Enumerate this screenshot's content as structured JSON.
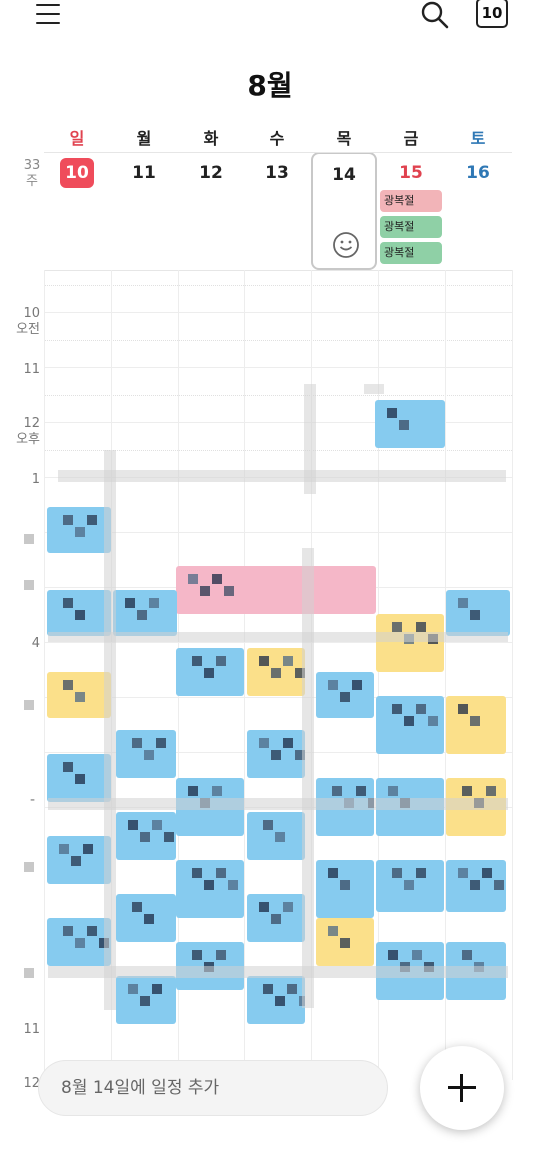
{
  "toolbar": {
    "menu_icon": "hamburger-menu-icon",
    "search_icon": "search-icon",
    "today_label": "10"
  },
  "month_title": "8월",
  "week": {
    "label_top": "33",
    "label_bottom": "주"
  },
  "weekdays": [
    {
      "label": "일",
      "color": "#e0424f"
    },
    {
      "label": "월",
      "color": "#222222"
    },
    {
      "label": "화",
      "color": "#222222"
    },
    {
      "label": "수",
      "color": "#222222"
    },
    {
      "label": "목",
      "color": "#222222"
    },
    {
      "label": "금",
      "color": "#222222"
    },
    {
      "label": "토",
      "color": "#2f78b5"
    }
  ],
  "dates": [
    {
      "day": "10",
      "color": "#ffffff"
    },
    {
      "day": "11",
      "color": "#222222"
    },
    {
      "day": "12",
      "color": "#222222"
    },
    {
      "day": "13",
      "color": "#222222"
    },
    {
      "day": "14",
      "color": "#222222"
    },
    {
      "day": "15",
      "color": "#e0424f"
    },
    {
      "day": "16",
      "color": "#2f78b5"
    }
  ],
  "holidays": [
    {
      "label": "광복절",
      "color": "#f2b4b8"
    },
    {
      "label": "광복절",
      "color": "#8fd0a6"
    },
    {
      "label": "광복절",
      "color": "#8fd0a6"
    }
  ],
  "hour_labels": [
    {
      "hour": "10",
      "period": "오전"
    },
    {
      "hour": "11",
      "period": ""
    },
    {
      "hour": "12",
      "period": "오후"
    },
    {
      "hour": "1",
      "period": ""
    },
    {
      "hour": "4",
      "period": ""
    },
    {
      "hour": "11",
      "period": ""
    },
    {
      "hour": "12",
      "period": ""
    }
  ],
  "stray_labels": [
    "-"
  ],
  "add_event_placeholder": "8월 14일에 일정 추가",
  "fab_icon": "plus-icon",
  "colors": {
    "today": "#ef4c5b",
    "event_blue": "#86cbef",
    "event_pink": "#f5b7c8",
    "event_yellow": "#fbe08a"
  }
}
